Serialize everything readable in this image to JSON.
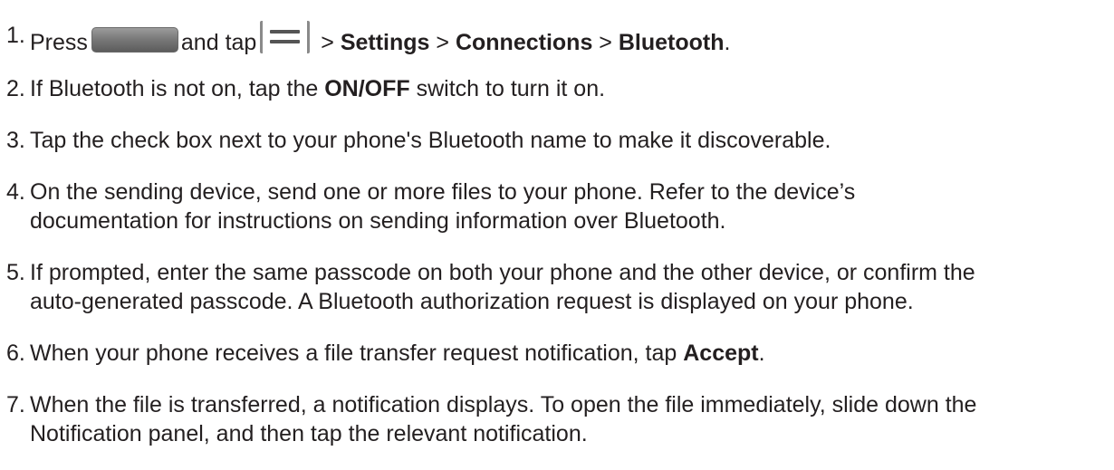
{
  "steps": [
    {
      "number": "1.",
      "press": "Press",
      "and_tap": "and tap",
      "sep1": " > ",
      "settings": "Settings",
      "sep2": " > ",
      "connections": "Connections",
      "sep3": " > ",
      "bluetooth": "Bluetooth",
      "end": ".",
      "home_icon": "home-key-icon",
      "menu_icon": "menu-key-icon"
    },
    {
      "number": "2.",
      "before": "If Bluetooth is not on, tap the ",
      "bold": "ON/OFF",
      "after": " switch to turn it on."
    },
    {
      "number": "3.",
      "text": "Tap the check box next to your phone's Bluetooth name to make it discoverable."
    },
    {
      "number": "4.",
      "line1": "On the sending device, send one or more files to your phone. Refer to the device’s",
      "line2": "documentation for instructions on sending information over Bluetooth."
    },
    {
      "number": "5.",
      "line1": "If prompted, enter the same passcode on both your phone and the other device, or confirm the",
      "line2": "auto-generated passcode. A Bluetooth authorization request is displayed on your phone."
    },
    {
      "number": "6.",
      "before": "When your phone receives a file transfer request notification, tap ",
      "bold": "Accept",
      "after": "."
    },
    {
      "number": "7.",
      "line1": "When the file is transferred, a notification displays. To open the file immediately, slide down the",
      "line2": "Notification panel, and then tap the relevant notification."
    }
  ]
}
